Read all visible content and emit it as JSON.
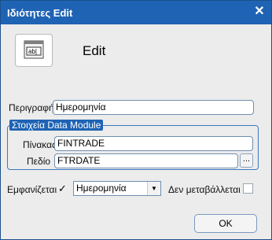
{
  "window": {
    "title": "Ιδιότητες Edit",
    "close_glyph": "✕",
    "heading": "Edit"
  },
  "icons": {
    "header": "edit-control-icon"
  },
  "form": {
    "description_label": "Περιγραφή",
    "description_value": "Ημερομηνία",
    "group_label": "Στοιχεία Data Module",
    "table_label": "Πίνακας",
    "table_value": "FINTRADE",
    "field_label": "Πεδίο",
    "field_value": "FTRDATE",
    "browse_label": "...",
    "visible_label": "Εμφανίζεται",
    "visible_checked": true,
    "visible_check_glyph": "✓",
    "mode_value": "Ημερομηνία",
    "mode_arrow": "▼",
    "readonly_label": "Δεν μεταβάλλεται",
    "readonly_checked": false
  },
  "buttons": {
    "ok": "OK"
  },
  "colors": {
    "titlebar": "#1f63b4",
    "group_border": "#3f78c0",
    "dialog_bg": "#ececec"
  }
}
